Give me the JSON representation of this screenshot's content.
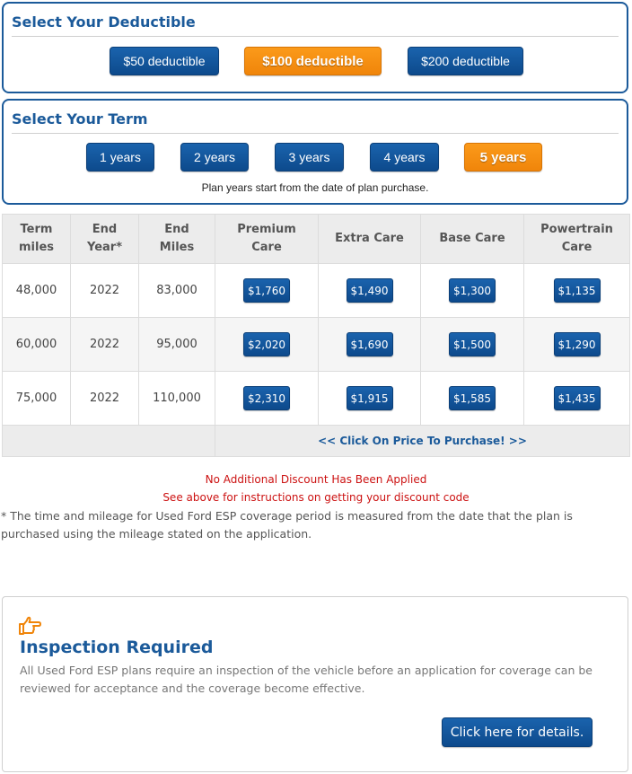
{
  "deductible": {
    "title": "Select Your Deductible",
    "options": [
      "$50 deductible",
      "$100 deductible",
      "$200 deductible"
    ],
    "selected": "$100 deductible"
  },
  "term": {
    "title": "Select Your Term",
    "options": [
      "1 years",
      "2 years",
      "3 years",
      "4 years",
      "5 years"
    ],
    "selected": "5 years",
    "note": "Plan years start from the date of plan purchase."
  },
  "table": {
    "headers": [
      [
        "Term",
        "miles"
      ],
      [
        "End",
        "Year*"
      ],
      [
        "End",
        "Miles"
      ],
      [
        "Premium",
        "Care"
      ],
      [
        "Extra Care"
      ],
      [
        "Base Care"
      ],
      [
        "Powertrain",
        "Care"
      ]
    ],
    "rows": [
      {
        "term_miles": "48,000",
        "end_year": "2022",
        "end_miles": "83,000",
        "prices": [
          "$1,760",
          "$1,490",
          "$1,300",
          "$1,135"
        ]
      },
      {
        "term_miles": "60,000",
        "end_year": "2022",
        "end_miles": "95,000",
        "prices": [
          "$2,020",
          "$1,690",
          "$1,500",
          "$1,290"
        ]
      },
      {
        "term_miles": "75,000",
        "end_year": "2022",
        "end_miles": "110,000",
        "prices": [
          "$2,310",
          "$1,915",
          "$1,585",
          "$1,435"
        ]
      }
    ],
    "footer_link": "<< Click On Price To Purchase! >>"
  },
  "discount": {
    "line1": "No Additional Discount Has Been Applied",
    "line2": "See above for instructions on getting your discount code"
  },
  "footnote": "* The time and mileage for Used Ford ESP coverage period is measured from the date that the plan is purchased using the mileage stated on the application.",
  "inspection": {
    "icon": "pointing-hand-icon",
    "title": "Inspection Required",
    "text": "All Used Ford ESP plans require an inspection of the vehicle before an application for coverage can be reviewed for acceptance and the coverage become effective.",
    "button": "Click here for details."
  },
  "colors": {
    "primary_blue": "#1b5a9a",
    "button_blue": "#0d4a8c",
    "accent_orange": "#f0850a",
    "alert_red": "#cc1111"
  }
}
